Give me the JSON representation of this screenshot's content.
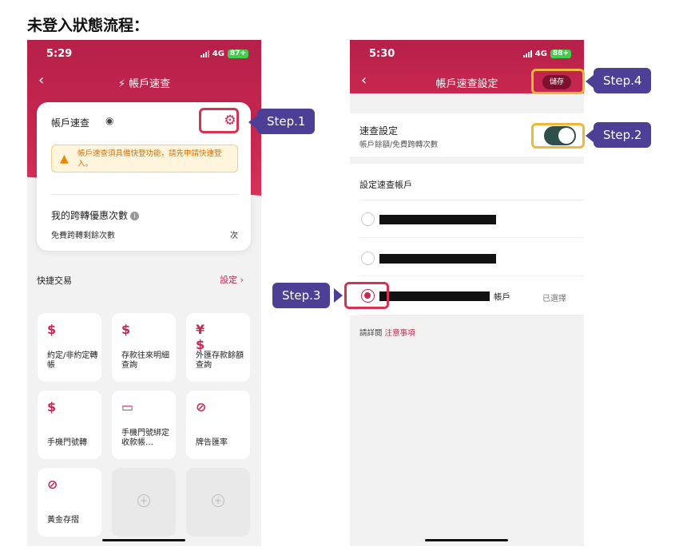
{
  "page_title": "未登入狀態流程：",
  "phone1": {
    "status": {
      "time": "5:29",
      "network": "4G",
      "battery": "87+"
    },
    "nav": {
      "back": "‹",
      "bolt": "⚡",
      "title": "帳戶速查"
    },
    "card": {
      "title": "帳戶速查",
      "eye_icon": "◉",
      "gear_icon": "⚙",
      "warning_text": "帳戶速查須具備快登功能，請先申請快速登入。",
      "warn_icon": "▲",
      "transfer_title": "我的跨轉優惠次數",
      "info_icon": "i",
      "free_label": "免費跨轉剩餘次數",
      "unit": "次"
    },
    "quick": {
      "title": "快捷交易",
      "settings": "設定 ›"
    },
    "tiles": [
      {
        "icon": "$",
        "label": "約定/非約定轉帳"
      },
      {
        "icon": "$",
        "label": "存款往來明細查詢"
      },
      {
        "icon": "¥$",
        "label": "外匯存款餘額查詢"
      },
      {
        "icon": "$",
        "label": "手機門號轉"
      },
      {
        "icon": "▭",
        "label": "手機門號綁定收款帳…"
      },
      {
        "icon": "⊘",
        "label": "牌告匯率"
      },
      {
        "icon": "⊘",
        "label": "黃金存摺"
      },
      {
        "icon": "+",
        "label": ""
      },
      {
        "icon": "+",
        "label": ""
      }
    ]
  },
  "phone2": {
    "status": {
      "time": "5:30",
      "network": "4G",
      "battery": "88+"
    },
    "nav": {
      "back": "‹",
      "title": "帳戶速查設定",
      "save": "儲存"
    },
    "fast": {
      "title": "速查設定",
      "subtitle": "帳戶餘額/免費跨轉次數",
      "enabled": true
    },
    "accounts_title": "設定速查帳戶",
    "accounts": [
      {
        "name": "",
        "selected": false,
        "selected_label": ""
      },
      {
        "name": "",
        "selected": false,
        "selected_label": ""
      },
      {
        "name": "帳戶",
        "selected": true,
        "selected_label": "已選擇"
      }
    ],
    "notice": {
      "prefix": "請詳閱",
      "link": "注意事項"
    }
  },
  "steps": {
    "step1": "Step.1",
    "step2": "Step.2",
    "step3": "Step.3",
    "step4": "Step.4"
  },
  "colors": {
    "brand": "#c8274f",
    "callout": "#4e3f96",
    "highlight": "#f2b63a",
    "toggle": "#2f4f4a"
  }
}
